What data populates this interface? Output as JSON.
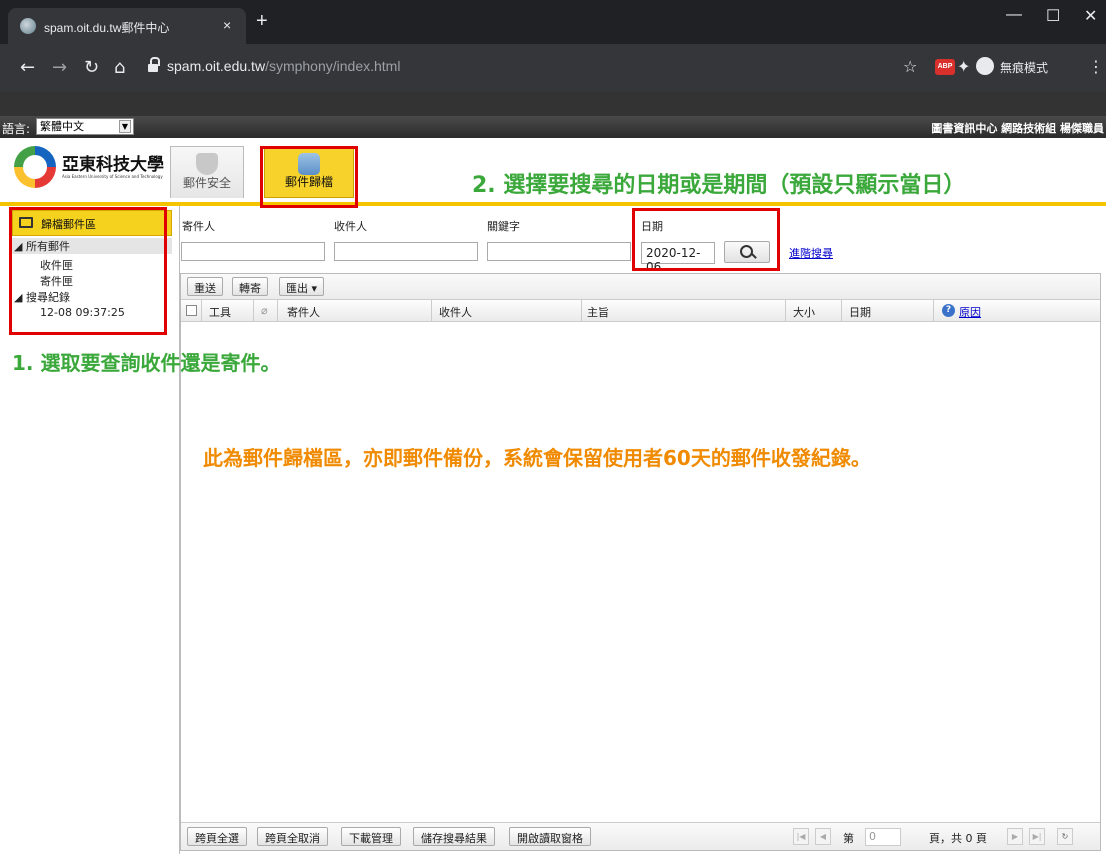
{
  "browser": {
    "tab_title": "spam.oit.du.tw郵件中心",
    "tab_close": "×",
    "new_tab": "+",
    "url_host": "spam.oit.edu.tw",
    "url_path": "/symphony/index.html",
    "incognito_label": "無痕模式",
    "abp_label": "ABP",
    "icons": [
      "back-icon",
      "forward-icon",
      "reload-icon",
      "home-icon",
      "lock-icon",
      "star-icon",
      "extensions-icon",
      "incognito-icon",
      "menu-icon"
    ]
  },
  "app": {
    "lang_label": "語言:",
    "lang_value": "繁體中文",
    "user_info": "圖書資訊中心 網路技術組 楊傑職員",
    "university_name": "亞東科技大學",
    "university_en": "Asia Eastern University of Science and Technology",
    "tabs": [
      {
        "label": "郵件安全",
        "icon": "shield-icon",
        "active": false
      },
      {
        "label": "郵件歸檔",
        "icon": "database-mail-icon",
        "active": true
      }
    ]
  },
  "sidebar": {
    "title": "歸檔郵件區",
    "items": [
      {
        "label": "所有郵件",
        "expanded": true
      },
      {
        "label": "收件匣"
      },
      {
        "label": "寄件匣"
      },
      {
        "label": "搜尋紀錄",
        "expanded": true
      },
      {
        "label": "12-08 09:37:25"
      }
    ]
  },
  "search": {
    "sender_label": "寄件人",
    "recipient_label": "收件人",
    "keyword_label": "關鍵字",
    "date_label": "日期",
    "date_value": "2020-12-06",
    "advanced_link": "進階搜尋"
  },
  "toolbar": {
    "resend": "重送",
    "forward": "轉寄",
    "export": "匯出"
  },
  "grid": {
    "columns": [
      "工具",
      "寄件人",
      "收件人",
      "主旨",
      "大小",
      "日期",
      "原因"
    ]
  },
  "footer": {
    "select_all_pages": "跨頁全選",
    "deselect_all_pages": "跨頁全取消",
    "download_mgmt": "下載管理",
    "save_results": "儲存搜尋結果",
    "open_reading_pane": "開啟讀取窗格",
    "page_prefix": "第",
    "page_value": "0",
    "page_suffix": "頁，共 0 頁"
  },
  "annotations": {
    "step1": "1. 選取要查詢收件還是寄件。",
    "step2": "2. 選擇要搜尋的日期或是期間（預設只顯示當日）",
    "note": "此為郵件歸檔區，亦即郵件備份，系統會保留使用者60天的郵件收發紀錄。",
    "color_red": "#e10000",
    "color_green": "#3aa83a",
    "color_orange": "#f08a00"
  }
}
